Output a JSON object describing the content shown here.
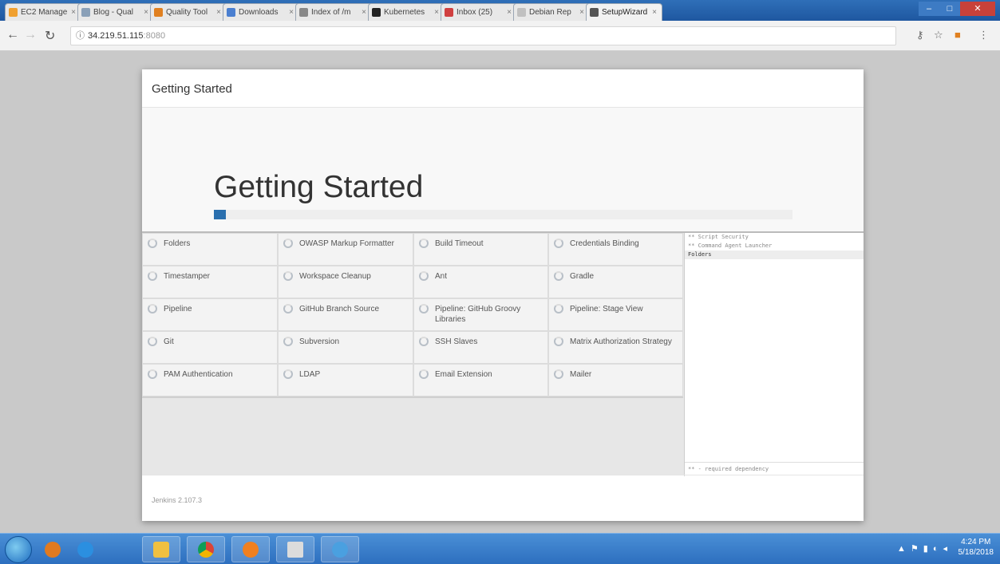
{
  "browser": {
    "tabs": [
      {
        "label": "EC2 Manage",
        "color": "#f0a030"
      },
      {
        "label": "Blog - Qual",
        "color": "#8aa0b8"
      },
      {
        "label": "Quality Tool",
        "color": "#e08020"
      },
      {
        "label": "Downloads",
        "color": "#4a7fd0"
      },
      {
        "label": "Index of /m",
        "color": "#888888"
      },
      {
        "label": "Kubernetes",
        "color": "#222222"
      },
      {
        "label": "Inbox (25)",
        "color": "#d04040"
      },
      {
        "label": "Debian Rep",
        "color": "#c0c0c0"
      },
      {
        "label": "SetupWizard",
        "color": "#555555"
      }
    ],
    "active_tab_index": 8,
    "url_host": "34.219.51.115",
    "url_port": ":8080"
  },
  "dialog": {
    "header_title": "Getting Started",
    "hero_title": "Getting Started",
    "progress": 0.02,
    "plugins": [
      "Folders",
      "OWASP Markup Formatter",
      "Build Timeout",
      "Credentials Binding",
      "Timestamper",
      "Workspace Cleanup",
      "Ant",
      "Gradle",
      "Pipeline",
      "GitHub Branch Source",
      "Pipeline: GitHub Groovy Libraries",
      "Pipeline: Stage View",
      "Git",
      "Subversion",
      "SSH Slaves",
      "Matrix Authorization Strategy",
      "PAM Authentication",
      "LDAP",
      "Email Extension",
      "Mailer"
    ],
    "dependencies": [
      "** Script Security",
      "** Command Agent Launcher",
      "Folders"
    ],
    "dependency_note": "** - required dependency",
    "version": "Jenkins 2.107.3"
  },
  "taskbar": {
    "time": "4:24 PM",
    "date": "5/18/2018"
  }
}
